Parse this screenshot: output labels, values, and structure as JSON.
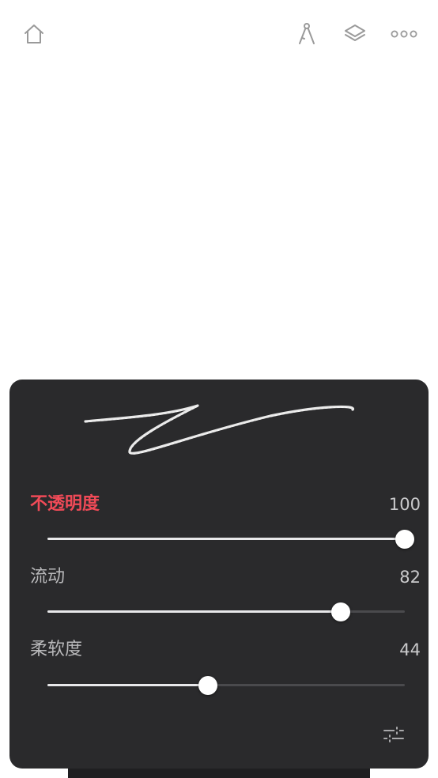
{
  "toolbar": {
    "icons": [
      "home-icon",
      "ruler-icon",
      "layers-icon",
      "more-icon"
    ]
  },
  "brush_panel": {
    "params": [
      {
        "label": "不透明度",
        "value": "100",
        "level": 1.0,
        "active": true
      },
      {
        "label": "流动",
        "value": "82",
        "level": 0.82,
        "active": false
      },
      {
        "label": "柔软度",
        "value": "44",
        "level": 0.45,
        "active": false
      }
    ],
    "settings_icon": "sliders-icon"
  },
  "colors": {
    "accent": "#f04a57",
    "panel_bg": "#2a2a2c",
    "canvas_bg": "#ffffff"
  }
}
